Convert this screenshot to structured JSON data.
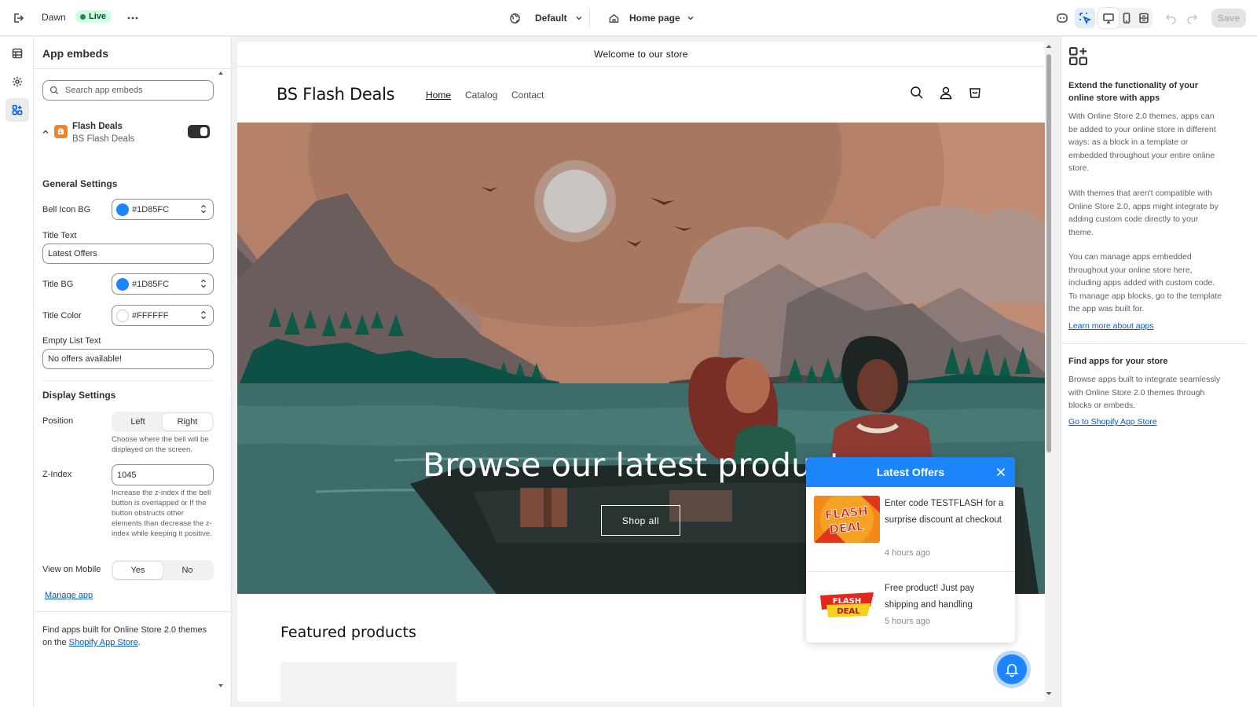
{
  "topbar": {
    "theme_name": "Dawn",
    "live_label": "Live",
    "locale_label": "Default",
    "page_label": "Home page",
    "save_label": "Save"
  },
  "left_panel": {
    "title": "App embeds",
    "search_placeholder": "Search app embeds",
    "app": {
      "name": "Flash Deals",
      "vendor": "BS Flash Deals",
      "enabled": true
    },
    "general_title": "General Settings",
    "bell_icon_bg_label": "Bell Icon BG",
    "bell_icon_bg_value": "#1D85FC",
    "title_text_label": "Title Text",
    "title_text_value": "Latest Offers",
    "title_bg_label": "Title BG",
    "title_bg_value": "#1D85FC",
    "title_color_label": "Title Color",
    "title_color_value": "#FFFFFF",
    "empty_list_label": "Empty List Text",
    "empty_list_value": "No offers available!",
    "display_title": "Display Settings",
    "position_label": "Position",
    "position_options": [
      "Left",
      "Right"
    ],
    "position_selected": "Right",
    "position_help": "Choose where the bell will be displayed on the screen.",
    "zindex_label": "Z-Index",
    "zindex_value": "1045",
    "zindex_help": "Increase the z-index if the bell button is overlapped or If the button obstructs other elements than decrease the z-index while keeping it positive.",
    "mobile_label": "View on Mobile",
    "mobile_options": [
      "Yes",
      "No"
    ],
    "mobile_selected": "Yes",
    "manage_app": "Manage app",
    "footer_text_1": "Find apps built for Online Store 2.0 themes on the ",
    "footer_link": "Shopify App Store",
    "footer_text_2": "."
  },
  "preview": {
    "announcement": "Welcome to our store",
    "store_name": "BS Flash Deals",
    "nav": [
      "Home",
      "Catalog",
      "Contact"
    ],
    "hero_title": "Browse our latest products",
    "hero_button": "Shop all",
    "featured_title": "Featured products",
    "popup": {
      "title": "Latest Offers",
      "offers": [
        {
          "text": "Enter code TESTFLASH for a surprise discount at checkout",
          "time": "4 hours ago",
          "badge_line1": "FLASH",
          "badge_line2": "DEAL"
        },
        {
          "text": "Free product! Just pay shipping and handling",
          "time": "5 hours ago",
          "badge_line1": "FLASH",
          "badge_line2": "DEAL"
        }
      ]
    }
  },
  "right_panel": {
    "heading": "Extend the functionality of your online store with apps",
    "p1": "With Online Store 2.0 themes, apps can be added to your online store in different ways: as a block in a template or embedded throughout your entire online store.",
    "p2": "With themes that aren't compatible with Online Store 2.0, apps might integrate by adding custom code directly to your theme.",
    "p3": "You can manage apps embedded throughout your online store here, including apps added with custom code. To manage app blocks, go to the template the app was built for.",
    "learn_more": "Learn more about apps",
    "find_title": "Find apps for your store",
    "find_text": "Browse apps built to integrate seamlessly with Online Store 2.0 themes through blocks or embeds.",
    "app_store_link": "Go to Shopify App Store"
  },
  "colors": {
    "accent": "#1D85FC",
    "live_bg": "#cdfee1",
    "link": "#005bd3"
  }
}
